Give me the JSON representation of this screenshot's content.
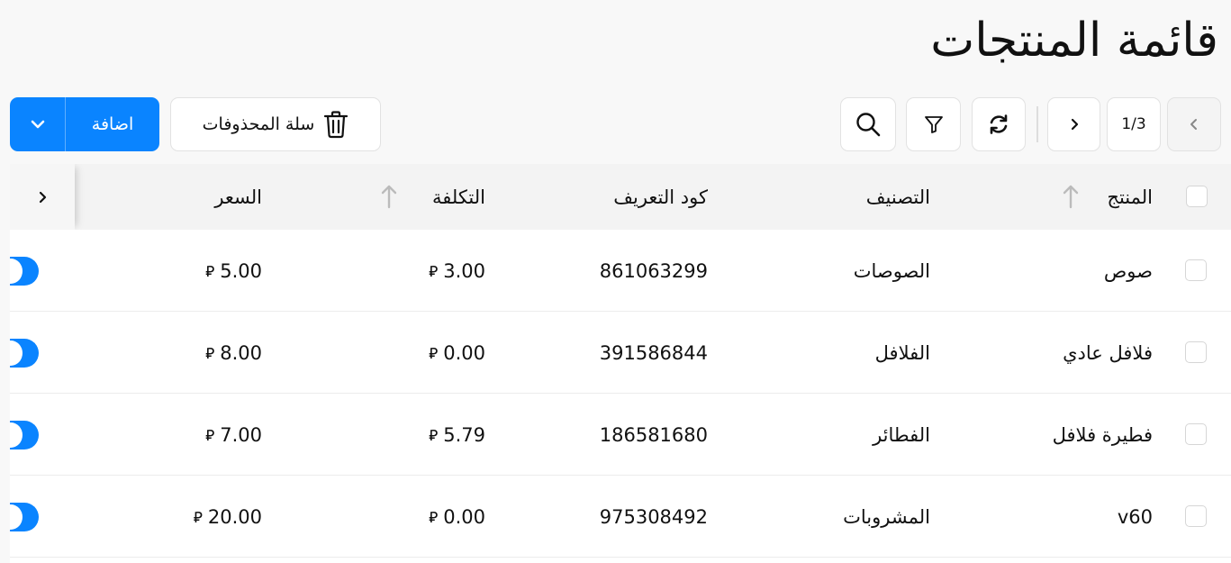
{
  "page": {
    "title": "قائمة المنتجات"
  },
  "toolbar": {
    "add_label": "اضافة",
    "trash_label": "سلة المحذوفات",
    "pagination": "1/3"
  },
  "table": {
    "columns": {
      "product": "المنتج",
      "category": "التصنيف",
      "code": "كود التعريف",
      "cost": "التكلفة",
      "price": "السعر"
    },
    "currency_symbol": "⃁",
    "rows": [
      {
        "product": "صوص",
        "category": "الصوصات",
        "code": "861063299",
        "cost": "3.00",
        "price": "5.00"
      },
      {
        "product": "فلافل عادي",
        "category": "الفلافل",
        "code": "391586844",
        "cost": "0.00",
        "price": "8.00"
      },
      {
        "product": "فطيرة فلافل",
        "category": "الفطائر",
        "code": "186581680",
        "cost": "5.79",
        "price": "7.00"
      },
      {
        "product": "v60",
        "category": "المشروبات",
        "code": "975308492",
        "cost": "0.00",
        "price": "20.00"
      }
    ]
  },
  "colors": {
    "accent": "#0a84ff",
    "header_bg": "#f3f3f3",
    "page_bg": "#f8f8f8"
  }
}
